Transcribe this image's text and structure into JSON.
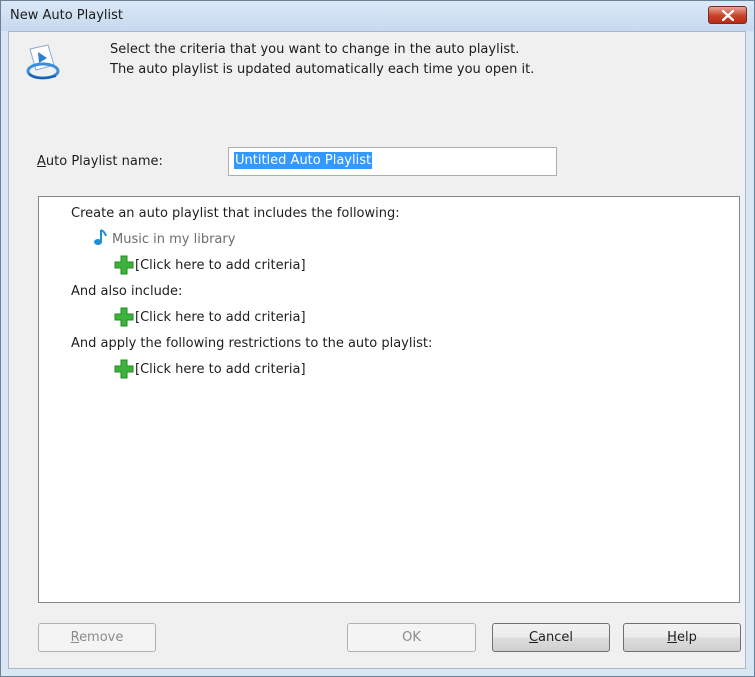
{
  "window": {
    "title": "New Auto Playlist"
  },
  "header": {
    "icon": "playlist-disc-icon",
    "instruction_line1": "Select the criteria that you want to change in the auto playlist.",
    "instruction_line2": "The auto playlist is updated automatically each time you open it."
  },
  "name_field": {
    "label_accel": "A",
    "label_rest": "uto Playlist name:",
    "value": "Untitled Auto Playlist"
  },
  "criteria": {
    "include_heading": "Create an auto playlist that includes the following:",
    "music_item": "Music in my library",
    "add_criteria_1": "[Click here to add criteria]",
    "also_heading": "And also include:",
    "add_criteria_2": "[Click here to add criteria]",
    "restrict_heading": "And apply the following restrictions to the auto playlist:",
    "add_criteria_3": "[Click here to add criteria]",
    "music_icon": "music-note-icon",
    "add_icon": "green-plus-icon"
  },
  "buttons": {
    "remove_accel": "R",
    "remove_rest": "emove",
    "ok": "OK",
    "cancel_accel": "C",
    "cancel_rest": "ancel",
    "help_accel": "H",
    "help_rest": "elp"
  },
  "colors": {
    "selection": "#3399ff",
    "plus_green": "#3cb43c",
    "note_blue": "#1a8fd8",
    "close_red": "#c7422a"
  }
}
